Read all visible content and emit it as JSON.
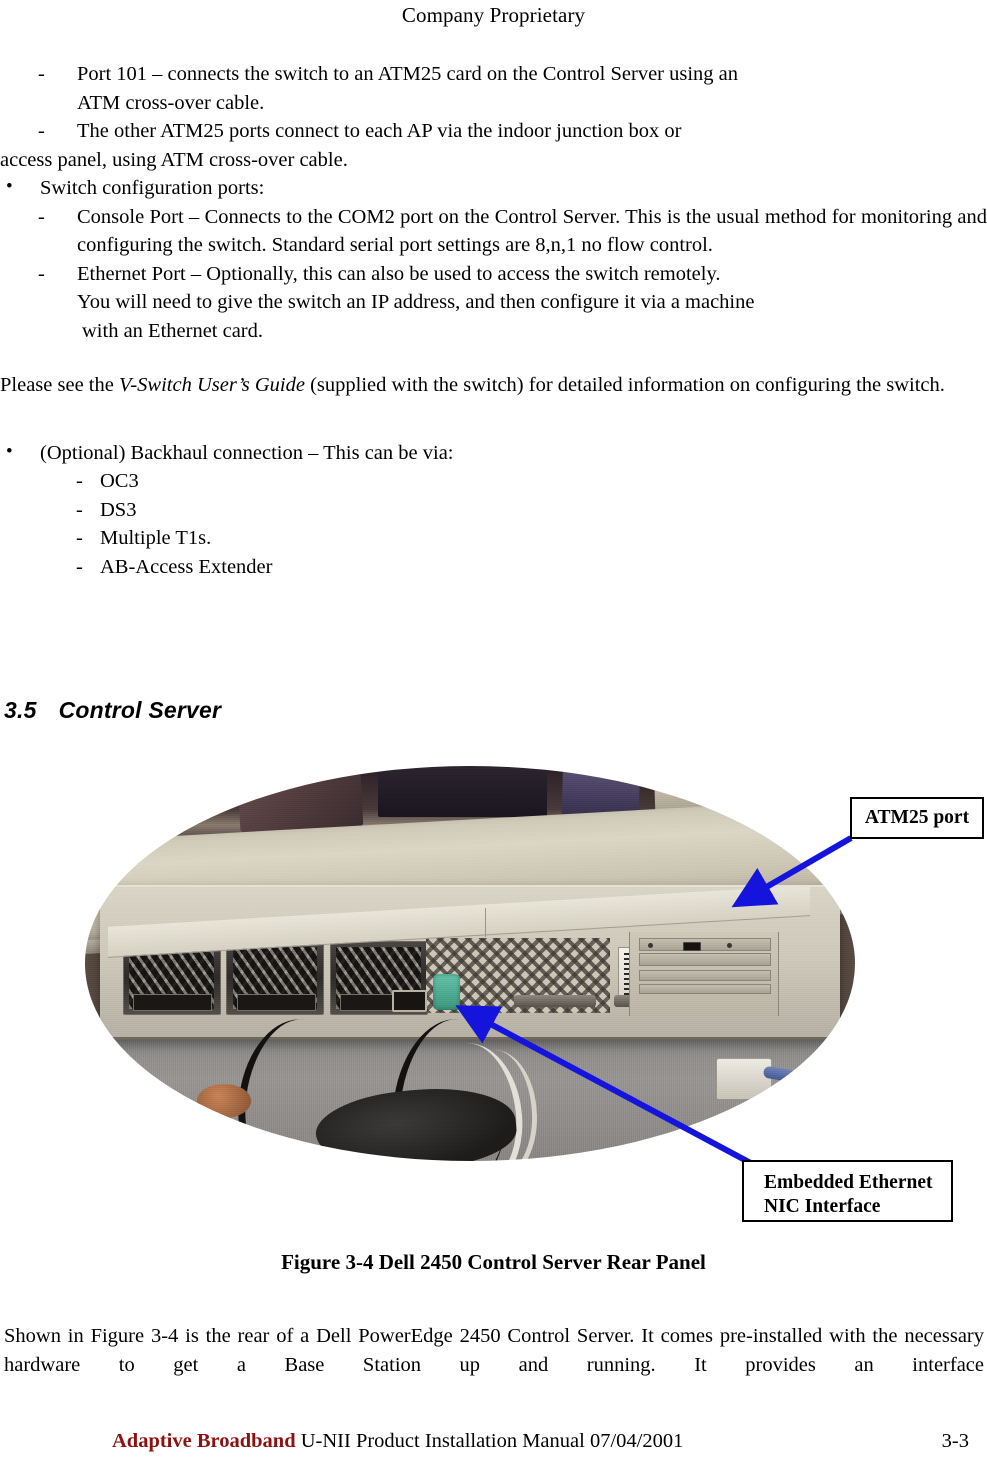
{
  "header": {
    "title": "Company Proprietary"
  },
  "body": {
    "list_switch_ports": [
      {
        "marker": "-",
        "line1": "Port 101 – connects the switch to an ATM25 card on the Control Server using an",
        "line2": "ATM cross-over cable."
      },
      {
        "marker": "-",
        "line1": "The other ATM25 ports connect to each AP via the indoor junction box or",
        "line2_flush": "access panel, using ATM  cross-over cable."
      }
    ],
    "bullet_switch_config": {
      "marker": "•",
      "label": "Switch configuration ports:",
      "items": [
        {
          "marker": "-",
          "text": "Console Port – Connects to the COM2 port on the Control Server.  This is the usual method for monitoring and configuring the switch. Standard serial port settings are 8,n,1 no flow control."
        },
        {
          "marker": "-",
          "line1": "Ethernet Port – Optionally, this can also be used to access the switch remotely.",
          "line2": "You will need to give the switch an IP address, and then configure it via a machine",
          "line3": " with an Ethernet card."
        }
      ]
    },
    "guide_paragraph": {
      "before": "Please see the ",
      "italic": "V-Switch User’s Guide",
      "after": " (supplied with the switch) for detailed information on configuring the switch."
    },
    "bullet_backhaul": {
      "marker": "•",
      "label": "(Optional) Backhaul connection – This can be via:",
      "options": [
        {
          "marker": "-",
          "text": "OC3"
        },
        {
          "marker": "-",
          "text": "DS3"
        },
        {
          "marker": "-",
          "text": "Multiple T1s."
        },
        {
          "marker": "-",
          "text": "AB-Access Extender"
        }
      ]
    }
  },
  "section": {
    "number": "3.5",
    "title": "Control Server"
  },
  "figure": {
    "photo_alt": "Dell PowerEdge 2450 rack server rear panel photograph, oval cropped",
    "callouts": [
      {
        "id": "atm25-port",
        "text": "ATM25 port"
      },
      {
        "id": "embedded-ethernet-nic",
        "line1": "Embedded Ethernet",
        "line2": "NIC Interface"
      }
    ],
    "arrow_color": "#1414DC",
    "caption": "Figure 3-4  Dell 2450 Control Server Rear Panel"
  },
  "closing_paragraph": "Shown in Figure 3-4 is the rear of a Dell PowerEdge 2450 Control Server.  It comes pre-installed with the necessary hardware to get a Base Station up and running.  It provides an interface",
  "footer": {
    "brand": "Adaptive Broadband",
    "manual": "U-NII Product Installation Manual  07/04/2001",
    "page_number": "3-3",
    "brand_color": "#8c1111"
  }
}
